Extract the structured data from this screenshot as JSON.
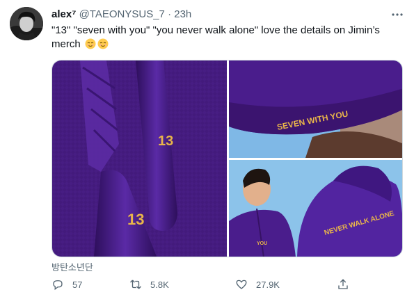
{
  "tweet": {
    "display_name": "alex⁷",
    "handle": "@TAEONYSUS_7",
    "separator": "·",
    "time": "23h",
    "text": "\"13\" \"seven with you\" \"you never walk alone\" love the details on Jimin’s merch",
    "media_caption": "방탄소년단",
    "replies": "57",
    "retweets": "5.8K",
    "likes": "27.9K",
    "media": {
      "left_text_top": "13",
      "left_text_bottom": "13",
      "top_right_text": "SEVEN WITH YOU",
      "bottom_right_text_hoodie": "YOU",
      "bottom_right_text_back": "NEVER WALK ALONE"
    }
  },
  "icons": {
    "more": "more-dots-icon",
    "reply": "reply-icon",
    "retweet": "retweet-icon",
    "like": "heart-icon",
    "share": "share-icon",
    "emoji": "relieved-face-emoji"
  },
  "colors": {
    "purple": "#4a1d8c",
    "purple_dark": "#361264",
    "gold": "#e9b54a",
    "gray_text": "#536471",
    "sky": "#7fb8e6"
  }
}
